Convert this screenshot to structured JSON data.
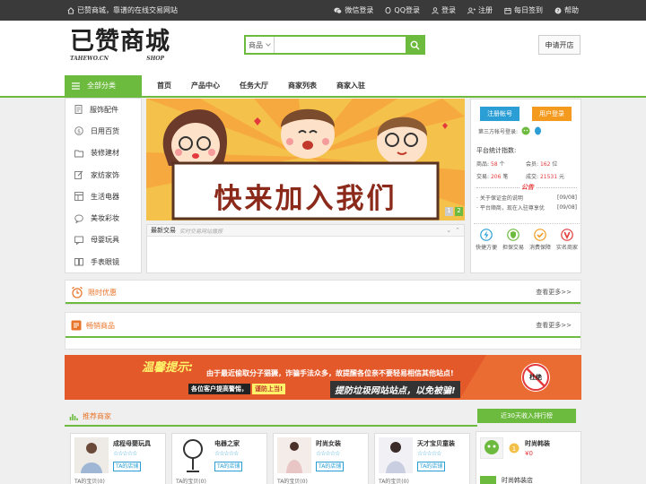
{
  "topbar": {
    "welcome": "已赞商城，靠谱的在线交易网站",
    "links": [
      {
        "label": "微信登录",
        "icon": "wechat-icon"
      },
      {
        "label": "QQ登录",
        "icon": "qq-icon"
      },
      {
        "label": "登录",
        "icon": "user-icon"
      },
      {
        "label": "注册",
        "icon": "user-plus-icon"
      },
      {
        "label": "每日签到",
        "icon": "calendar-icon"
      },
      {
        "label": "帮助",
        "icon": "help-icon"
      }
    ]
  },
  "header": {
    "logo_text": "已赞商城",
    "logo_sub_left": "TAHEWO.CN",
    "logo_sub_right": "SHOP",
    "search_scope": "商品",
    "search_value": "",
    "open_shop": "申请开店"
  },
  "nav": {
    "all_categories": "全部分类",
    "items": [
      "首页",
      "产品中心",
      "任务大厅",
      "商家列表",
      "商家入驻"
    ]
  },
  "categories": [
    {
      "label": "服饰配件",
      "icon": "document-icon"
    },
    {
      "label": "日用百货",
      "icon": "coin-icon"
    },
    {
      "label": "装修建材",
      "icon": "folder-icon"
    },
    {
      "label": "家纺家饰",
      "icon": "edit-icon"
    },
    {
      "label": "生活电器",
      "icon": "layout-icon"
    },
    {
      "label": "美妆彩妆",
      "icon": "chat-icon"
    },
    {
      "label": "母婴玩具",
      "icon": "message-icon"
    },
    {
      "label": "手表眼镜",
      "icon": "book-icon"
    }
  ],
  "banner": {
    "slogan": "快来加入我们",
    "pages": [
      "1",
      "2"
    ]
  },
  "trades": {
    "title": "最新交易",
    "subtitle": "实时交易网站播报",
    "rows": []
  },
  "sidebar": {
    "register": "注册帐号",
    "login": "用户登录",
    "third_party": "第三方帐号登录:",
    "stats_title": "平台统计指数:",
    "stats": [
      {
        "label": "商品:",
        "value": "58",
        "unit": "个"
      },
      {
        "label": "会员:",
        "value": "162",
        "unit": "位"
      },
      {
        "label": "交易:",
        "value": "206",
        "unit": "笔"
      },
      {
        "label": "成交:",
        "value": "21531",
        "unit": "元"
      }
    ],
    "notice_tab": "公告",
    "notices": [
      {
        "text": "· 关于保证金的说明",
        "date": "[09/08]"
      },
      {
        "text": "· 平台顺商，现在入驻尊享优",
        "date": "[09/08]"
      }
    ],
    "services": [
      {
        "label": "快捷方便",
        "icon": "lightning-icon",
        "color": "#2aa0d8"
      },
      {
        "label": "担保交易",
        "icon": "shield-icon",
        "color": "#6dbb3e"
      },
      {
        "label": "消费保障",
        "icon": "check-icon",
        "color": "#f39a1f"
      },
      {
        "label": "实名商家",
        "icon": "v-icon",
        "color": "#e4393c"
      }
    ]
  },
  "sections": {
    "flash": {
      "title": "限时优惠",
      "more": "查看更多>>"
    },
    "hot": {
      "title": "畅销商品",
      "more": "查看更多>>"
    }
  },
  "ad": {
    "headline": "温馨提示:",
    "line1": "由于最近偷取分子猖獗，诈骗手法众多，故提醒各位亲不要轻易相信其他站点!",
    "line2a": "各位客户提高警惕，",
    "line2b": "谨防上当!",
    "line2c": "提防垃圾网站站点，以免被骗!",
    "stamp": "杜绝"
  },
  "recommend": {
    "title": "推荐商家",
    "rank_button": "近30天收入排行榜",
    "shops": [
      {
        "name": "成程母婴玩具",
        "stars": "☆☆☆☆☆",
        "tag": "TA的店铺",
        "link": "TA的宝贝(0)"
      },
      {
        "name": "电器之家",
        "stars": "☆☆☆☆☆",
        "tag": "TA的店铺",
        "link": "TA的宝贝(0)"
      },
      {
        "name": "时尚女装",
        "stars": "☆☆☆☆☆",
        "tag": "TA的店铺",
        "link": "TA的宝贝(0)"
      },
      {
        "name": "天才宝贝童装",
        "stars": "☆☆☆☆☆",
        "tag": "TA的店铺",
        "link": "TA的宝贝(0)"
      }
    ],
    "ranking": [
      {
        "name": "时尚韩装",
        "amount": "¥0"
      },
      {
        "name": "时尚韩装店",
        "amount": ""
      }
    ]
  },
  "colors": {
    "accent": "#6dbb3e",
    "topbar": "#3a3a3a",
    "orange": "#e8742a",
    "blue": "#2a9ed5"
  }
}
